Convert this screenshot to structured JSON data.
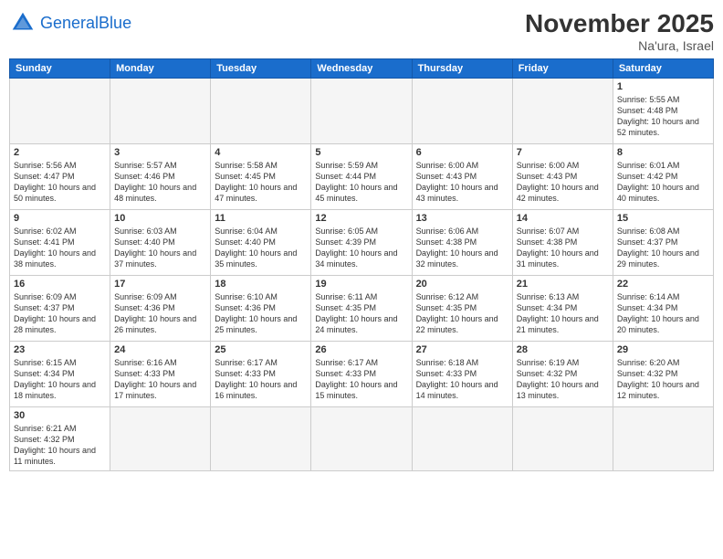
{
  "header": {
    "logo_general": "General",
    "logo_blue": "Blue",
    "month_title": "November 2025",
    "location": "Na'ura, Israel"
  },
  "days_of_week": [
    "Sunday",
    "Monday",
    "Tuesday",
    "Wednesday",
    "Thursday",
    "Friday",
    "Saturday"
  ],
  "weeks": [
    [
      {
        "day": "",
        "info": ""
      },
      {
        "day": "",
        "info": ""
      },
      {
        "day": "",
        "info": ""
      },
      {
        "day": "",
        "info": ""
      },
      {
        "day": "",
        "info": ""
      },
      {
        "day": "",
        "info": ""
      },
      {
        "day": "1",
        "info": "Sunrise: 5:55 AM\nSunset: 4:48 PM\nDaylight: 10 hours and 52 minutes."
      }
    ],
    [
      {
        "day": "2",
        "info": "Sunrise: 5:56 AM\nSunset: 4:47 PM\nDaylight: 10 hours and 50 minutes."
      },
      {
        "day": "3",
        "info": "Sunrise: 5:57 AM\nSunset: 4:46 PM\nDaylight: 10 hours and 48 minutes."
      },
      {
        "day": "4",
        "info": "Sunrise: 5:58 AM\nSunset: 4:45 PM\nDaylight: 10 hours and 47 minutes."
      },
      {
        "day": "5",
        "info": "Sunrise: 5:59 AM\nSunset: 4:44 PM\nDaylight: 10 hours and 45 minutes."
      },
      {
        "day": "6",
        "info": "Sunrise: 6:00 AM\nSunset: 4:43 PM\nDaylight: 10 hours and 43 minutes."
      },
      {
        "day": "7",
        "info": "Sunrise: 6:00 AM\nSunset: 4:43 PM\nDaylight: 10 hours and 42 minutes."
      },
      {
        "day": "8",
        "info": "Sunrise: 6:01 AM\nSunset: 4:42 PM\nDaylight: 10 hours and 40 minutes."
      }
    ],
    [
      {
        "day": "9",
        "info": "Sunrise: 6:02 AM\nSunset: 4:41 PM\nDaylight: 10 hours and 38 minutes."
      },
      {
        "day": "10",
        "info": "Sunrise: 6:03 AM\nSunset: 4:40 PM\nDaylight: 10 hours and 37 minutes."
      },
      {
        "day": "11",
        "info": "Sunrise: 6:04 AM\nSunset: 4:40 PM\nDaylight: 10 hours and 35 minutes."
      },
      {
        "day": "12",
        "info": "Sunrise: 6:05 AM\nSunset: 4:39 PM\nDaylight: 10 hours and 34 minutes."
      },
      {
        "day": "13",
        "info": "Sunrise: 6:06 AM\nSunset: 4:38 PM\nDaylight: 10 hours and 32 minutes."
      },
      {
        "day": "14",
        "info": "Sunrise: 6:07 AM\nSunset: 4:38 PM\nDaylight: 10 hours and 31 minutes."
      },
      {
        "day": "15",
        "info": "Sunrise: 6:08 AM\nSunset: 4:37 PM\nDaylight: 10 hours and 29 minutes."
      }
    ],
    [
      {
        "day": "16",
        "info": "Sunrise: 6:09 AM\nSunset: 4:37 PM\nDaylight: 10 hours and 28 minutes."
      },
      {
        "day": "17",
        "info": "Sunrise: 6:09 AM\nSunset: 4:36 PM\nDaylight: 10 hours and 26 minutes."
      },
      {
        "day": "18",
        "info": "Sunrise: 6:10 AM\nSunset: 4:36 PM\nDaylight: 10 hours and 25 minutes."
      },
      {
        "day": "19",
        "info": "Sunrise: 6:11 AM\nSunset: 4:35 PM\nDaylight: 10 hours and 24 minutes."
      },
      {
        "day": "20",
        "info": "Sunrise: 6:12 AM\nSunset: 4:35 PM\nDaylight: 10 hours and 22 minutes."
      },
      {
        "day": "21",
        "info": "Sunrise: 6:13 AM\nSunset: 4:34 PM\nDaylight: 10 hours and 21 minutes."
      },
      {
        "day": "22",
        "info": "Sunrise: 6:14 AM\nSunset: 4:34 PM\nDaylight: 10 hours and 20 minutes."
      }
    ],
    [
      {
        "day": "23",
        "info": "Sunrise: 6:15 AM\nSunset: 4:34 PM\nDaylight: 10 hours and 18 minutes."
      },
      {
        "day": "24",
        "info": "Sunrise: 6:16 AM\nSunset: 4:33 PM\nDaylight: 10 hours and 17 minutes."
      },
      {
        "day": "25",
        "info": "Sunrise: 6:17 AM\nSunset: 4:33 PM\nDaylight: 10 hours and 16 minutes."
      },
      {
        "day": "26",
        "info": "Sunrise: 6:17 AM\nSunset: 4:33 PM\nDaylight: 10 hours and 15 minutes."
      },
      {
        "day": "27",
        "info": "Sunrise: 6:18 AM\nSunset: 4:33 PM\nDaylight: 10 hours and 14 minutes."
      },
      {
        "day": "28",
        "info": "Sunrise: 6:19 AM\nSunset: 4:32 PM\nDaylight: 10 hours and 13 minutes."
      },
      {
        "day": "29",
        "info": "Sunrise: 6:20 AM\nSunset: 4:32 PM\nDaylight: 10 hours and 12 minutes."
      }
    ],
    [
      {
        "day": "30",
        "info": "Sunrise: 6:21 AM\nSunset: 4:32 PM\nDaylight: 10 hours and 11 minutes."
      },
      {
        "day": "",
        "info": ""
      },
      {
        "day": "",
        "info": ""
      },
      {
        "day": "",
        "info": ""
      },
      {
        "day": "",
        "info": ""
      },
      {
        "day": "",
        "info": ""
      },
      {
        "day": "",
        "info": ""
      }
    ]
  ]
}
